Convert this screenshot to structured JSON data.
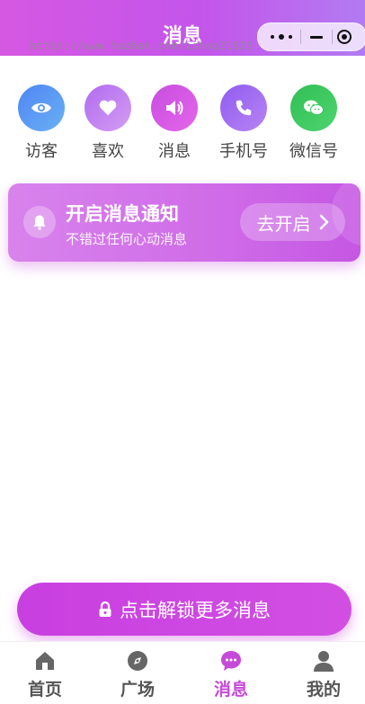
{
  "header": {
    "title": "消息",
    "watermark": "https://www.huzhan.com/ishop21923"
  },
  "quick_actions": [
    {
      "label": "访客",
      "icon": "eye-icon",
      "color": "#5e9bf3"
    },
    {
      "label": "喜欢",
      "icon": "heart-icon",
      "color": "#c27ff0"
    },
    {
      "label": "消息",
      "icon": "speaker-icon",
      "color": "#d44fe2"
    },
    {
      "label": "手机号",
      "icon": "phone-icon",
      "color": "#a56af3"
    },
    {
      "label": "微信号",
      "icon": "wechat-icon",
      "color": "#3cc65f"
    }
  ],
  "notify_banner": {
    "title": "开启消息通知",
    "subtitle": "不错过任何心动消息",
    "button_label": "去开启"
  },
  "unlock_button": {
    "label": "点击解锁更多消息"
  },
  "tabbar": {
    "items": [
      {
        "label": "首页",
        "icon": "home-icon",
        "active": false
      },
      {
        "label": "广场",
        "icon": "compass-icon",
        "active": false
      },
      {
        "label": "消息",
        "icon": "chat-bubble-icon",
        "active": true
      },
      {
        "label": "我的",
        "icon": "user-icon",
        "active": false
      }
    ],
    "active_color": "#c64ad9",
    "inactive_color": "#555555"
  }
}
